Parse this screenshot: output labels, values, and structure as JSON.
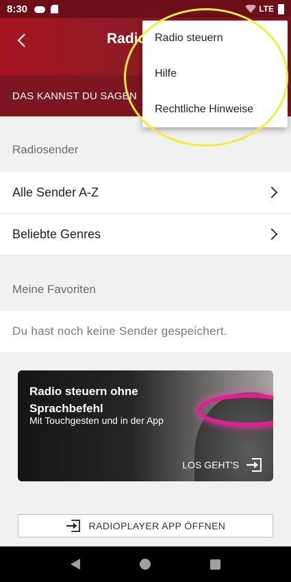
{
  "status_bar": {
    "time": "8:30",
    "network": "LTE"
  },
  "app_bar": {
    "title": "Radio"
  },
  "banner": {
    "text": "DAS KANNST DU SAGEN"
  },
  "sections": {
    "radiosender_header": "Radiosender",
    "alle_sender": "Alle Sender A-Z",
    "beliebte_genres": "Beliebte Genres",
    "favoriten_header": "Meine Favoriten",
    "favoriten_empty": "Du hast noch keine Sender gespeichert."
  },
  "promo": {
    "headline": "Radio steuern ohne Sprachbefehl",
    "subline": "Mit Touchgesten und in der App",
    "cta": "LOS GEHT'S"
  },
  "open_button": {
    "label": "RADIOPLAYER APP ÖFFNEN"
  },
  "menu": {
    "items": [
      {
        "label": "Radio steuern"
      },
      {
        "label": "Hilfe"
      },
      {
        "label": "Rechtliche Hinweise"
      }
    ]
  },
  "colors": {
    "brand_red": "#8f1b25",
    "magenta_ring": "#e0208f",
    "highlight": "#f2ee3a"
  }
}
